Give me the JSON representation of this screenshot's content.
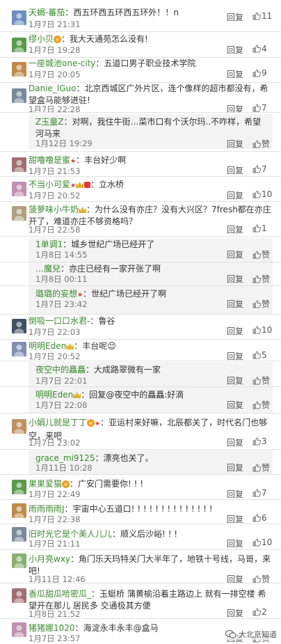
{
  "reply_label": "回复",
  "like_label": "赞",
  "watermark": "大北京知道",
  "comments": [
    {
      "user": "天蝎-蕃茄",
      "body": "西五环西五环西五环外！！n",
      "time": "1月7日 21:31",
      "likes": "11"
    },
    {
      "user": "缪小贝",
      "badges": [
        "vip"
      ],
      "body": "我大天通苑怎么没有!",
      "time": "1月7日 19:28",
      "likes": "4"
    },
    {
      "user": "一座城池one-city",
      "body": "五道口男子职业技术学院",
      "time": "1月7日 20:05",
      "likes": "9"
    },
    {
      "user": "Danie_lGuo",
      "body": "北京西城区广外片区，连个像样的超市都没有，希望盒马能够进驻!",
      "time": "1月7日 22:28",
      "likes": "7"
    },
    {
      "user": "Z玉童Z",
      "reply": true,
      "body": "对啊，我住牛街…菜市口有个沃尔玛..不咋样，希望河马来",
      "time": "1月12日 19:29",
      "likes": ""
    },
    {
      "user": "甜噜噜是蜜",
      "badges": [
        "star"
      ],
      "body": "丰台好少啊",
      "time": "1月7日 21:53",
      "likes": "7"
    },
    {
      "user": "不当小可爱",
      "badges": [
        "star",
        "crown",
        "cm"
      ],
      "body": "立水桥",
      "time": "1月7日 20:52",
      "likes": "10"
    },
    {
      "user": "菠萝味小牛奶",
      "badges": [
        "crown"
      ],
      "body": "为什么没有亦庄？没有大兴区？7fresh都在亦庄开了，难道亦庄不够资格吗？",
      "time": "1月7日 22:58",
      "likes": "1"
    },
    {
      "user": "1单调1",
      "reply": true,
      "body": "城乡世纪广场已经开了",
      "time": "1月8日 14:55",
      "likes": ""
    },
    {
      "user": "…魔兒",
      "reply": true,
      "body": "亦庄已经有一家开张了啊",
      "time": "1月8日 00:11",
      "likes": ""
    },
    {
      "user": "璐璐的妄想",
      "reply": true,
      "badges": [
        "star"
      ],
      "body": "世纪广场已经开了啊",
      "time": "1月7日 23:42",
      "likes": ""
    },
    {
      "user": "倒吸一口口水君-",
      "body": "鲁谷",
      "time": "1月7日 22:03",
      "likes": "10"
    },
    {
      "user": "明明Eden",
      "badges": [
        "crown"
      ],
      "body": "丰台呢😌",
      "time": "1月7日 20:52",
      "likes": "5"
    },
    {
      "user": "夜空中的矗矗",
      "reply": true,
      "body": "大成路翠微有一家",
      "time": "1月7日 22:01",
      "likes": ""
    },
    {
      "user": "明明Eden",
      "reply": true,
      "badges": [
        "crown"
      ],
      "body": "回复@夜空中的矗矗:好滴",
      "time": "1月7日 22:08",
      "likes": ""
    },
    {
      "user": "小娟儿就是丁丁",
      "badges": [
        "vip",
        "star"
      ],
      "body": "亚运村来好嘛，北辰都关了，时代名门也够空，来吧",
      "time": "1月7日 23:02",
      "likes": "3"
    },
    {
      "user": "grace_mi9125",
      "reply": true,
      "body": "漂亮也关了。",
      "time": "1月11日 10:28",
      "likes": ""
    },
    {
      "user": "果果爱猫",
      "badges": [
        "vip"
      ],
      "body": "广安门需要你! ! !",
      "time": "1月7日 22:49",
      "likes": "7"
    },
    {
      "user": "雨雨雨雨J",
      "body": "宇宙中心五道口! ! ! ! ! ! ! ! ! ! ! ! ! !",
      "time": "1月7日 22:38",
      "likes": "6"
    },
    {
      "user": "旧时光它是个美人儿儿",
      "body": "顺义后沙峪! ! !",
      "time": "1月7日 21:11",
      "likes": "10"
    },
    {
      "user": "小月亮wxy",
      "body": "角门乐天玛特关门大半年了，地铁十号线，马哥，来吧!",
      "time": "1月11日 12:46",
      "likes": ""
    },
    {
      "user": "香瓜甜瓜哈密瓜_",
      "body": "玉蜓桥 蒲黄榆沿着主路边上 就有一排空楼 希望开在那儿 居民多 交通极其方便",
      "time": "1月8日 21:52",
      "likes": "2"
    },
    {
      "user": "猪猪娜1020",
      "body": "海淀永丰永丰@盒马",
      "time": "1月7日 23:57",
      "likes": ""
    }
  ],
  "colors": {
    "name": "#3a8a2e",
    "reply_bg": "#f3f3f3"
  }
}
